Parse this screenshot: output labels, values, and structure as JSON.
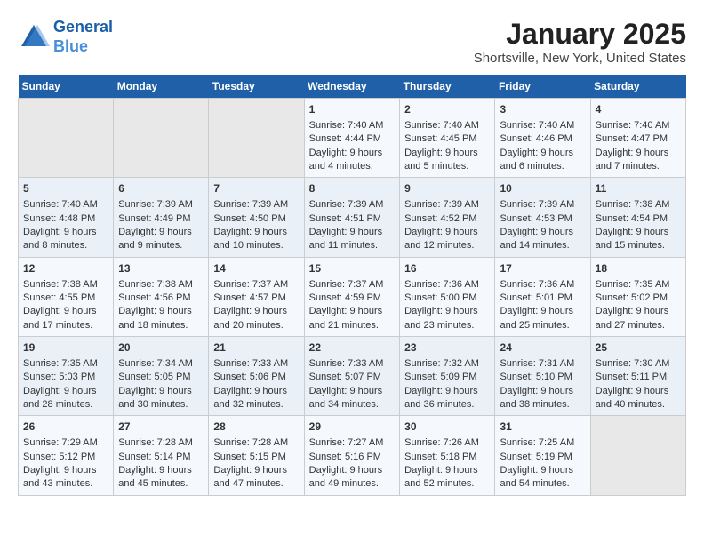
{
  "header": {
    "logo_line1": "General",
    "logo_line2": "Blue",
    "title": "January 2025",
    "subtitle": "Shortsville, New York, United States"
  },
  "days_of_week": [
    "Sunday",
    "Monday",
    "Tuesday",
    "Wednesday",
    "Thursday",
    "Friday",
    "Saturday"
  ],
  "weeks": [
    [
      {
        "day": "",
        "sunrise": "",
        "sunset": "",
        "daylight": "",
        "empty": true
      },
      {
        "day": "",
        "sunrise": "",
        "sunset": "",
        "daylight": "",
        "empty": true
      },
      {
        "day": "",
        "sunrise": "",
        "sunset": "",
        "daylight": "",
        "empty": true
      },
      {
        "day": "1",
        "sunrise": "Sunrise: 7:40 AM",
        "sunset": "Sunset: 4:44 PM",
        "daylight": "Daylight: 9 hours and 4 minutes."
      },
      {
        "day": "2",
        "sunrise": "Sunrise: 7:40 AM",
        "sunset": "Sunset: 4:45 PM",
        "daylight": "Daylight: 9 hours and 5 minutes."
      },
      {
        "day": "3",
        "sunrise": "Sunrise: 7:40 AM",
        "sunset": "Sunset: 4:46 PM",
        "daylight": "Daylight: 9 hours and 6 minutes."
      },
      {
        "day": "4",
        "sunrise": "Sunrise: 7:40 AM",
        "sunset": "Sunset: 4:47 PM",
        "daylight": "Daylight: 9 hours and 7 minutes."
      }
    ],
    [
      {
        "day": "5",
        "sunrise": "Sunrise: 7:40 AM",
        "sunset": "Sunset: 4:48 PM",
        "daylight": "Daylight: 9 hours and 8 minutes."
      },
      {
        "day": "6",
        "sunrise": "Sunrise: 7:39 AM",
        "sunset": "Sunset: 4:49 PM",
        "daylight": "Daylight: 9 hours and 9 minutes."
      },
      {
        "day": "7",
        "sunrise": "Sunrise: 7:39 AM",
        "sunset": "Sunset: 4:50 PM",
        "daylight": "Daylight: 9 hours and 10 minutes."
      },
      {
        "day": "8",
        "sunrise": "Sunrise: 7:39 AM",
        "sunset": "Sunset: 4:51 PM",
        "daylight": "Daylight: 9 hours and 11 minutes."
      },
      {
        "day": "9",
        "sunrise": "Sunrise: 7:39 AM",
        "sunset": "Sunset: 4:52 PM",
        "daylight": "Daylight: 9 hours and 12 minutes."
      },
      {
        "day": "10",
        "sunrise": "Sunrise: 7:39 AM",
        "sunset": "Sunset: 4:53 PM",
        "daylight": "Daylight: 9 hours and 14 minutes."
      },
      {
        "day": "11",
        "sunrise": "Sunrise: 7:38 AM",
        "sunset": "Sunset: 4:54 PM",
        "daylight": "Daylight: 9 hours and 15 minutes."
      }
    ],
    [
      {
        "day": "12",
        "sunrise": "Sunrise: 7:38 AM",
        "sunset": "Sunset: 4:55 PM",
        "daylight": "Daylight: 9 hours and 17 minutes."
      },
      {
        "day": "13",
        "sunrise": "Sunrise: 7:38 AM",
        "sunset": "Sunset: 4:56 PM",
        "daylight": "Daylight: 9 hours and 18 minutes."
      },
      {
        "day": "14",
        "sunrise": "Sunrise: 7:37 AM",
        "sunset": "Sunset: 4:57 PM",
        "daylight": "Daylight: 9 hours and 20 minutes."
      },
      {
        "day": "15",
        "sunrise": "Sunrise: 7:37 AM",
        "sunset": "Sunset: 4:59 PM",
        "daylight": "Daylight: 9 hours and 21 minutes."
      },
      {
        "day": "16",
        "sunrise": "Sunrise: 7:36 AM",
        "sunset": "Sunset: 5:00 PM",
        "daylight": "Daylight: 9 hours and 23 minutes."
      },
      {
        "day": "17",
        "sunrise": "Sunrise: 7:36 AM",
        "sunset": "Sunset: 5:01 PM",
        "daylight": "Daylight: 9 hours and 25 minutes."
      },
      {
        "day": "18",
        "sunrise": "Sunrise: 7:35 AM",
        "sunset": "Sunset: 5:02 PM",
        "daylight": "Daylight: 9 hours and 27 minutes."
      }
    ],
    [
      {
        "day": "19",
        "sunrise": "Sunrise: 7:35 AM",
        "sunset": "Sunset: 5:03 PM",
        "daylight": "Daylight: 9 hours and 28 minutes."
      },
      {
        "day": "20",
        "sunrise": "Sunrise: 7:34 AM",
        "sunset": "Sunset: 5:05 PM",
        "daylight": "Daylight: 9 hours and 30 minutes."
      },
      {
        "day": "21",
        "sunrise": "Sunrise: 7:33 AM",
        "sunset": "Sunset: 5:06 PM",
        "daylight": "Daylight: 9 hours and 32 minutes."
      },
      {
        "day": "22",
        "sunrise": "Sunrise: 7:33 AM",
        "sunset": "Sunset: 5:07 PM",
        "daylight": "Daylight: 9 hours and 34 minutes."
      },
      {
        "day": "23",
        "sunrise": "Sunrise: 7:32 AM",
        "sunset": "Sunset: 5:09 PM",
        "daylight": "Daylight: 9 hours and 36 minutes."
      },
      {
        "day": "24",
        "sunrise": "Sunrise: 7:31 AM",
        "sunset": "Sunset: 5:10 PM",
        "daylight": "Daylight: 9 hours and 38 minutes."
      },
      {
        "day": "25",
        "sunrise": "Sunrise: 7:30 AM",
        "sunset": "Sunset: 5:11 PM",
        "daylight": "Daylight: 9 hours and 40 minutes."
      }
    ],
    [
      {
        "day": "26",
        "sunrise": "Sunrise: 7:29 AM",
        "sunset": "Sunset: 5:12 PM",
        "daylight": "Daylight: 9 hours and 43 minutes."
      },
      {
        "day": "27",
        "sunrise": "Sunrise: 7:28 AM",
        "sunset": "Sunset: 5:14 PM",
        "daylight": "Daylight: 9 hours and 45 minutes."
      },
      {
        "day": "28",
        "sunrise": "Sunrise: 7:28 AM",
        "sunset": "Sunset: 5:15 PM",
        "daylight": "Daylight: 9 hours and 47 minutes."
      },
      {
        "day": "29",
        "sunrise": "Sunrise: 7:27 AM",
        "sunset": "Sunset: 5:16 PM",
        "daylight": "Daylight: 9 hours and 49 minutes."
      },
      {
        "day": "30",
        "sunrise": "Sunrise: 7:26 AM",
        "sunset": "Sunset: 5:18 PM",
        "daylight": "Daylight: 9 hours and 52 minutes."
      },
      {
        "day": "31",
        "sunrise": "Sunrise: 7:25 AM",
        "sunset": "Sunset: 5:19 PM",
        "daylight": "Daylight: 9 hours and 54 minutes."
      },
      {
        "day": "",
        "sunrise": "",
        "sunset": "",
        "daylight": "",
        "empty": true
      }
    ]
  ]
}
